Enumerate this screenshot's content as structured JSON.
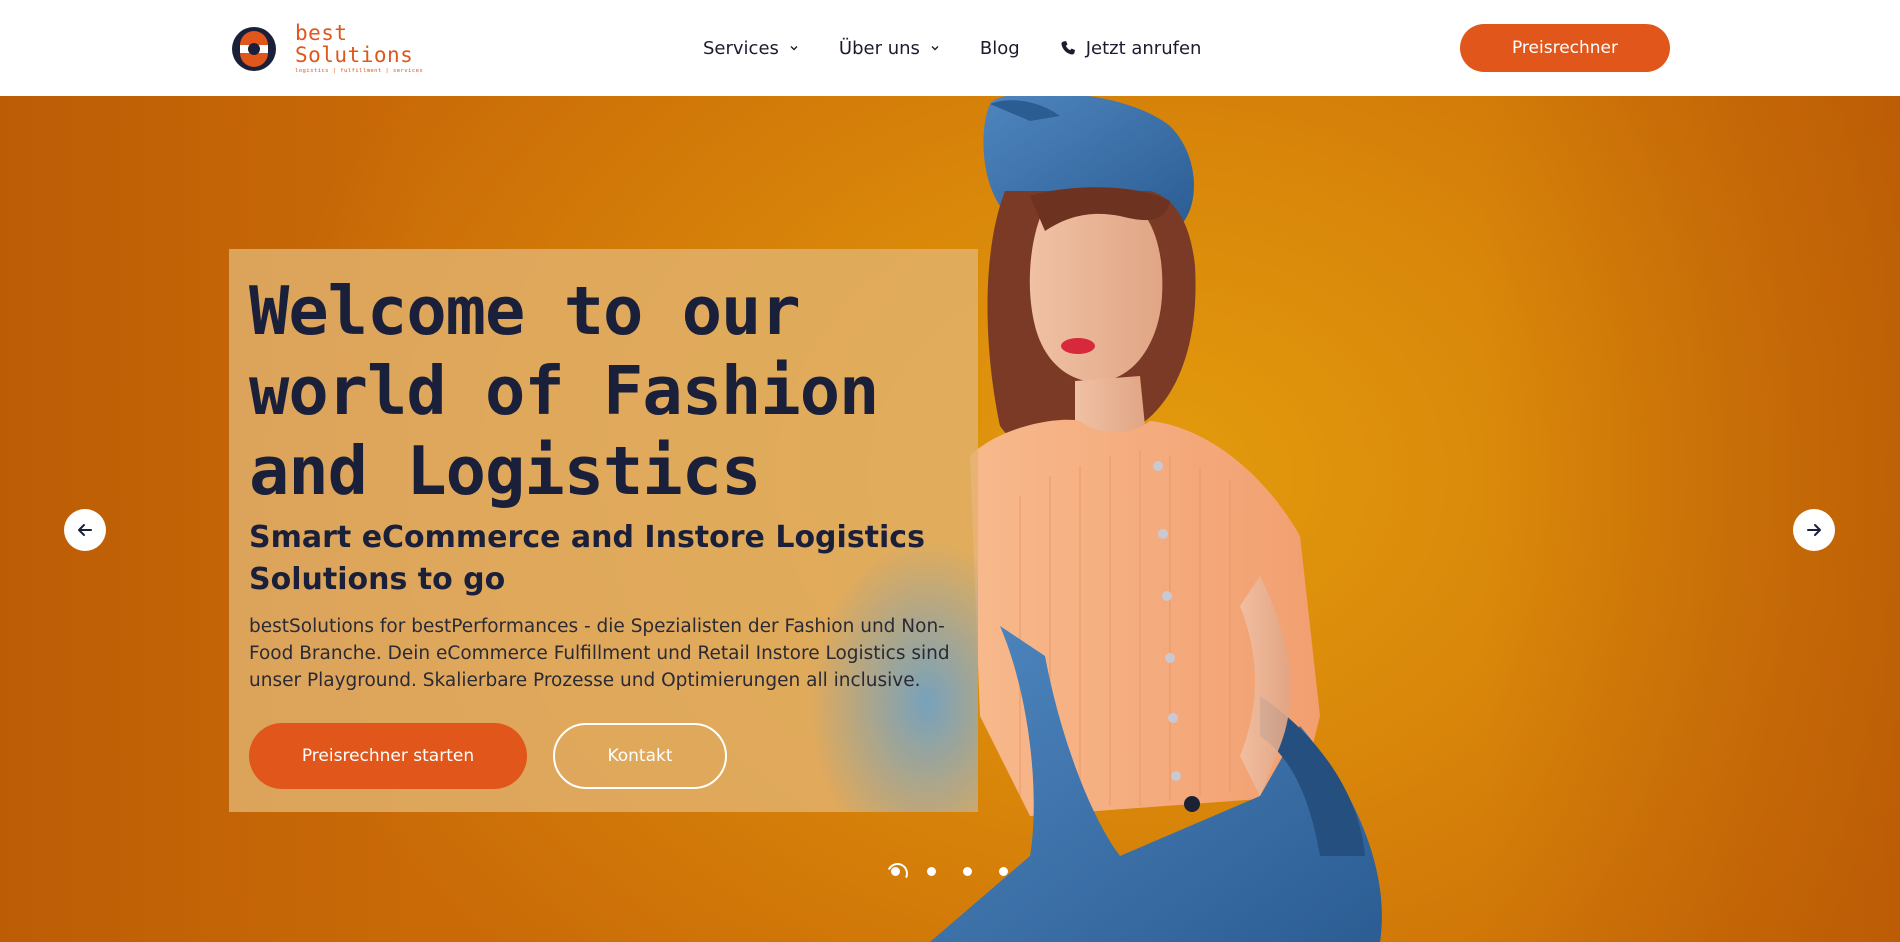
{
  "brand": {
    "line1": "best",
    "line2": "Solutions",
    "tagline": "logistics | fulfillment | services",
    "accent_color": "#e0561b",
    "dark_color": "#1a1f3a"
  },
  "nav": {
    "items": [
      {
        "label": "Services",
        "has_dropdown": true
      },
      {
        "label": "Über uns",
        "has_dropdown": true
      },
      {
        "label": "Blog",
        "has_dropdown": false
      }
    ],
    "phone_label": "Jetzt anrufen",
    "phone_icon": "phone-icon"
  },
  "header_cta": {
    "label": "Preisrechner"
  },
  "hero": {
    "title": "Welcome to our world of Fashion and Logistics",
    "subtitle": "Smart eCommerce and Instore Logistics Solutions to go",
    "text": "bestSolutions for bestPerformances - die Spezialisten der Fashion und Non-Food Branche. Dein eCommerce Fulfillment und Retail Instore Logistics sind unser Playground. Skalierbare Prozesse und Optimierungen all inclusive.",
    "primary_button": "Preisrechner starten",
    "secondary_button": "Kontakt",
    "background_color": "#d9870a"
  },
  "slider": {
    "prev_icon": "arrow-left-icon",
    "next_icon": "arrow-right-icon",
    "slide_count": 4,
    "active_index": 0
  }
}
